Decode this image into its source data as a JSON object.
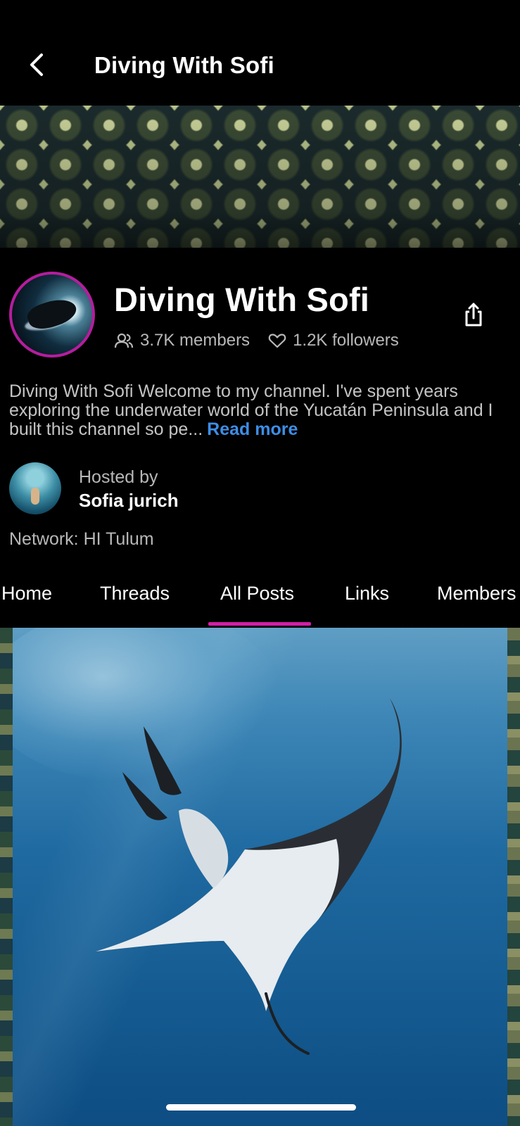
{
  "header": {
    "title": "Diving With Sofi"
  },
  "channel": {
    "name": "Diving With Sofi",
    "members": "3.7K members",
    "followers": "1.2K followers",
    "description": "Diving With Sofi Welcome to my channel. I've spent years exploring the underwater world of the Yucatán Peninsula and I built this channel so pe...",
    "read_more": "Read more",
    "hosted_by_label": "Hosted by",
    "host_name": "Sofia jurich",
    "network": "Network: HI Tulum"
  },
  "tabs": [
    {
      "label": "Home"
    },
    {
      "label": "Threads"
    },
    {
      "label": "All Posts",
      "active": true
    },
    {
      "label": "Links"
    },
    {
      "label": "Members"
    }
  ],
  "icons": {
    "back": "chevron-left-icon",
    "share": "share-icon",
    "members": "people-icon",
    "followers": "heart-icon"
  },
  "colors": {
    "background": "#000000",
    "accent": "#d41ea7",
    "link": "#3d8ee6",
    "avatar_ring": "#b51d9e"
  }
}
